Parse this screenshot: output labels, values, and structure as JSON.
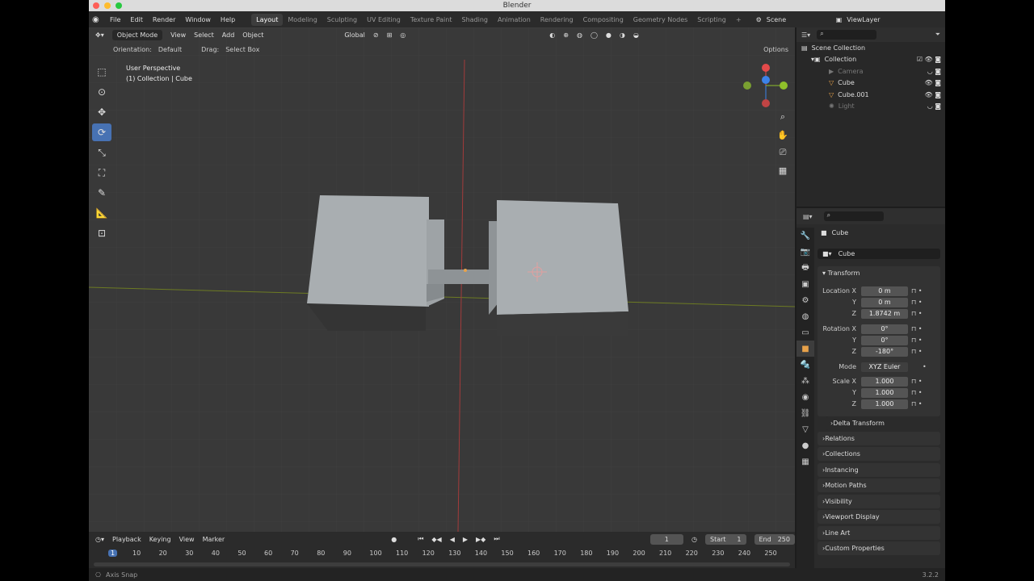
{
  "window": {
    "title": "Blender",
    "version": "3.2.2"
  },
  "menu": [
    "File",
    "Edit",
    "Render",
    "Window",
    "Help"
  ],
  "workspaces": [
    "Layout",
    "Modeling",
    "Sculpting",
    "UV Editing",
    "Texture Paint",
    "Shading",
    "Animation",
    "Rendering",
    "Compositing",
    "Geometry Nodes",
    "Scripting"
  ],
  "active_workspace": "Layout",
  "scene_name": "Scene",
  "view_layer": "ViewLayer",
  "viewport": {
    "mode": "Object Mode",
    "menus": [
      "View",
      "Select",
      "Add",
      "Object"
    ],
    "transform_orientation": "Global",
    "orientation_label": "Orientation:",
    "orientation_value": "Default",
    "drag_label": "Drag:",
    "drag_value": "Select Box",
    "options_label": "Options",
    "overlay_line1": "User Perspective",
    "overlay_line2": "(1) Collection | Cube",
    "gizmo_axes": {
      "x": "X",
      "y": "Y",
      "z": "Z"
    },
    "active_tool": "rotate",
    "colors": {
      "bg": "#393939",
      "x_axis": "#e44a4a",
      "y_axis": "#8fbf2a",
      "z_axis": "#3c82e8"
    }
  },
  "outliner": {
    "title": "Scene Collection",
    "items": [
      {
        "label": "Collection",
        "dim": false
      },
      {
        "label": "Camera",
        "dim": true
      },
      {
        "label": "Cube",
        "dim": false
      },
      {
        "label": "Cube.001",
        "dim": false
      },
      {
        "label": "Light",
        "dim": true
      }
    ]
  },
  "properties": {
    "object_name": "Cube",
    "data_name": "Cube",
    "transform_title": "Transform",
    "fields": [
      {
        "label": "Location X",
        "value": "0 m"
      },
      {
        "label": "Y",
        "value": "0 m"
      },
      {
        "label": "Z",
        "value": "1.8742 m"
      },
      {
        "label": "Rotation X",
        "value": "0°"
      },
      {
        "label": "Y",
        "value": "0°"
      },
      {
        "label": "Z",
        "value": "-180°"
      },
      {
        "label": "Mode",
        "value": "XYZ Euler"
      },
      {
        "label": "Scale X",
        "value": "1.000"
      },
      {
        "label": "Y",
        "value": "1.000"
      },
      {
        "label": "Z",
        "value": "1.000"
      }
    ],
    "delta_transform": "Delta Transform",
    "sections": [
      "Relations",
      "Collections",
      "Instancing",
      "Motion Paths",
      "Visibility",
      "Viewport Display",
      "Line Art",
      "Custom Properties"
    ]
  },
  "timeline": {
    "menus": [
      "Playback",
      "Keying",
      "View",
      "Marker"
    ],
    "current_frame": "1",
    "start_label": "Start",
    "start": "1",
    "end_label": "End",
    "end": "250",
    "ticks": [
      "1",
      "10",
      "20",
      "30",
      "40",
      "50",
      "60",
      "70",
      "80",
      "90",
      "100",
      "110",
      "120",
      "130",
      "140",
      "150",
      "160",
      "170",
      "180",
      "190",
      "200",
      "210",
      "220",
      "230",
      "240",
      "250"
    ]
  },
  "status": {
    "left": "Axis Snap"
  }
}
